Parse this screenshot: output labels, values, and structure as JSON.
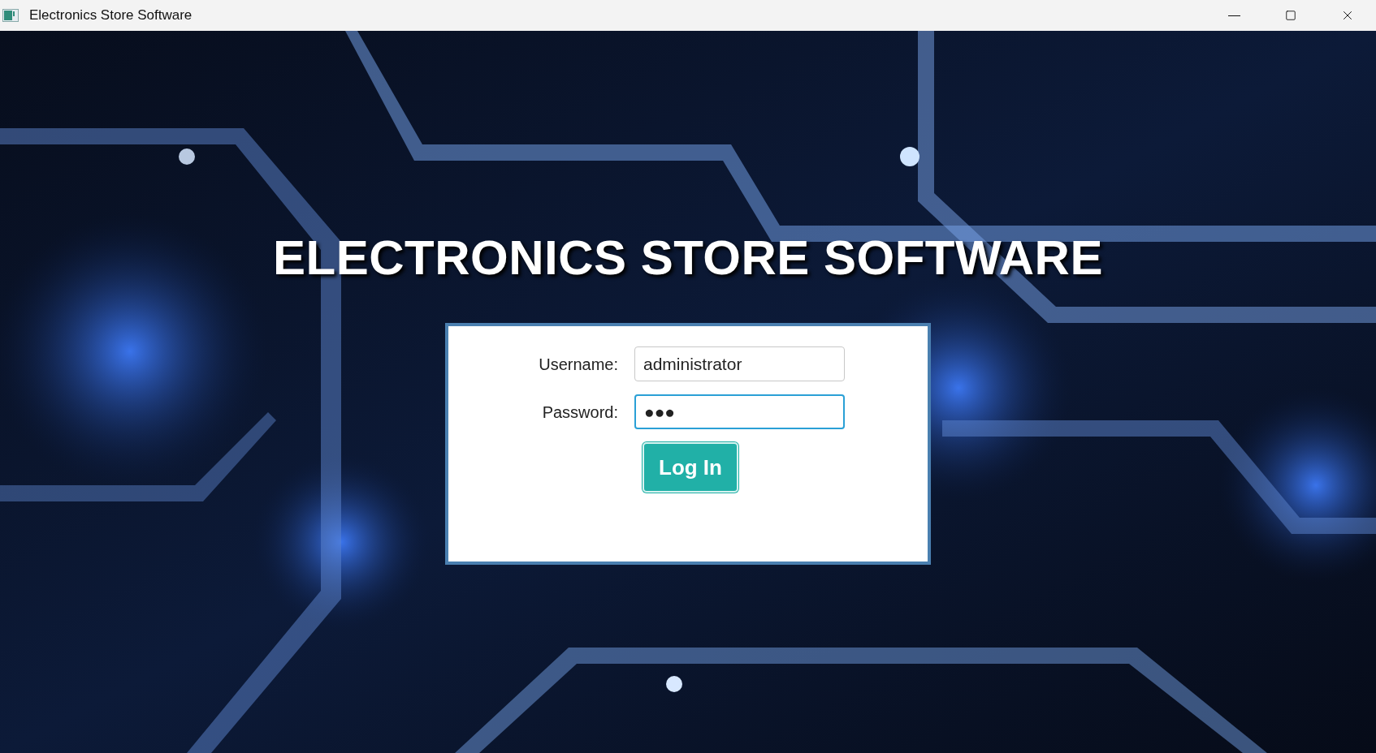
{
  "window": {
    "title": "Electronics Store Software"
  },
  "heading": "ELECTRONICS STORE SOFTWARE",
  "login": {
    "fields": [
      {
        "label": "Username:",
        "value": "administrator",
        "focused": false
      },
      {
        "label": "Password:",
        "value": "●●●",
        "focused": true
      }
    ],
    "button": "Log In"
  }
}
